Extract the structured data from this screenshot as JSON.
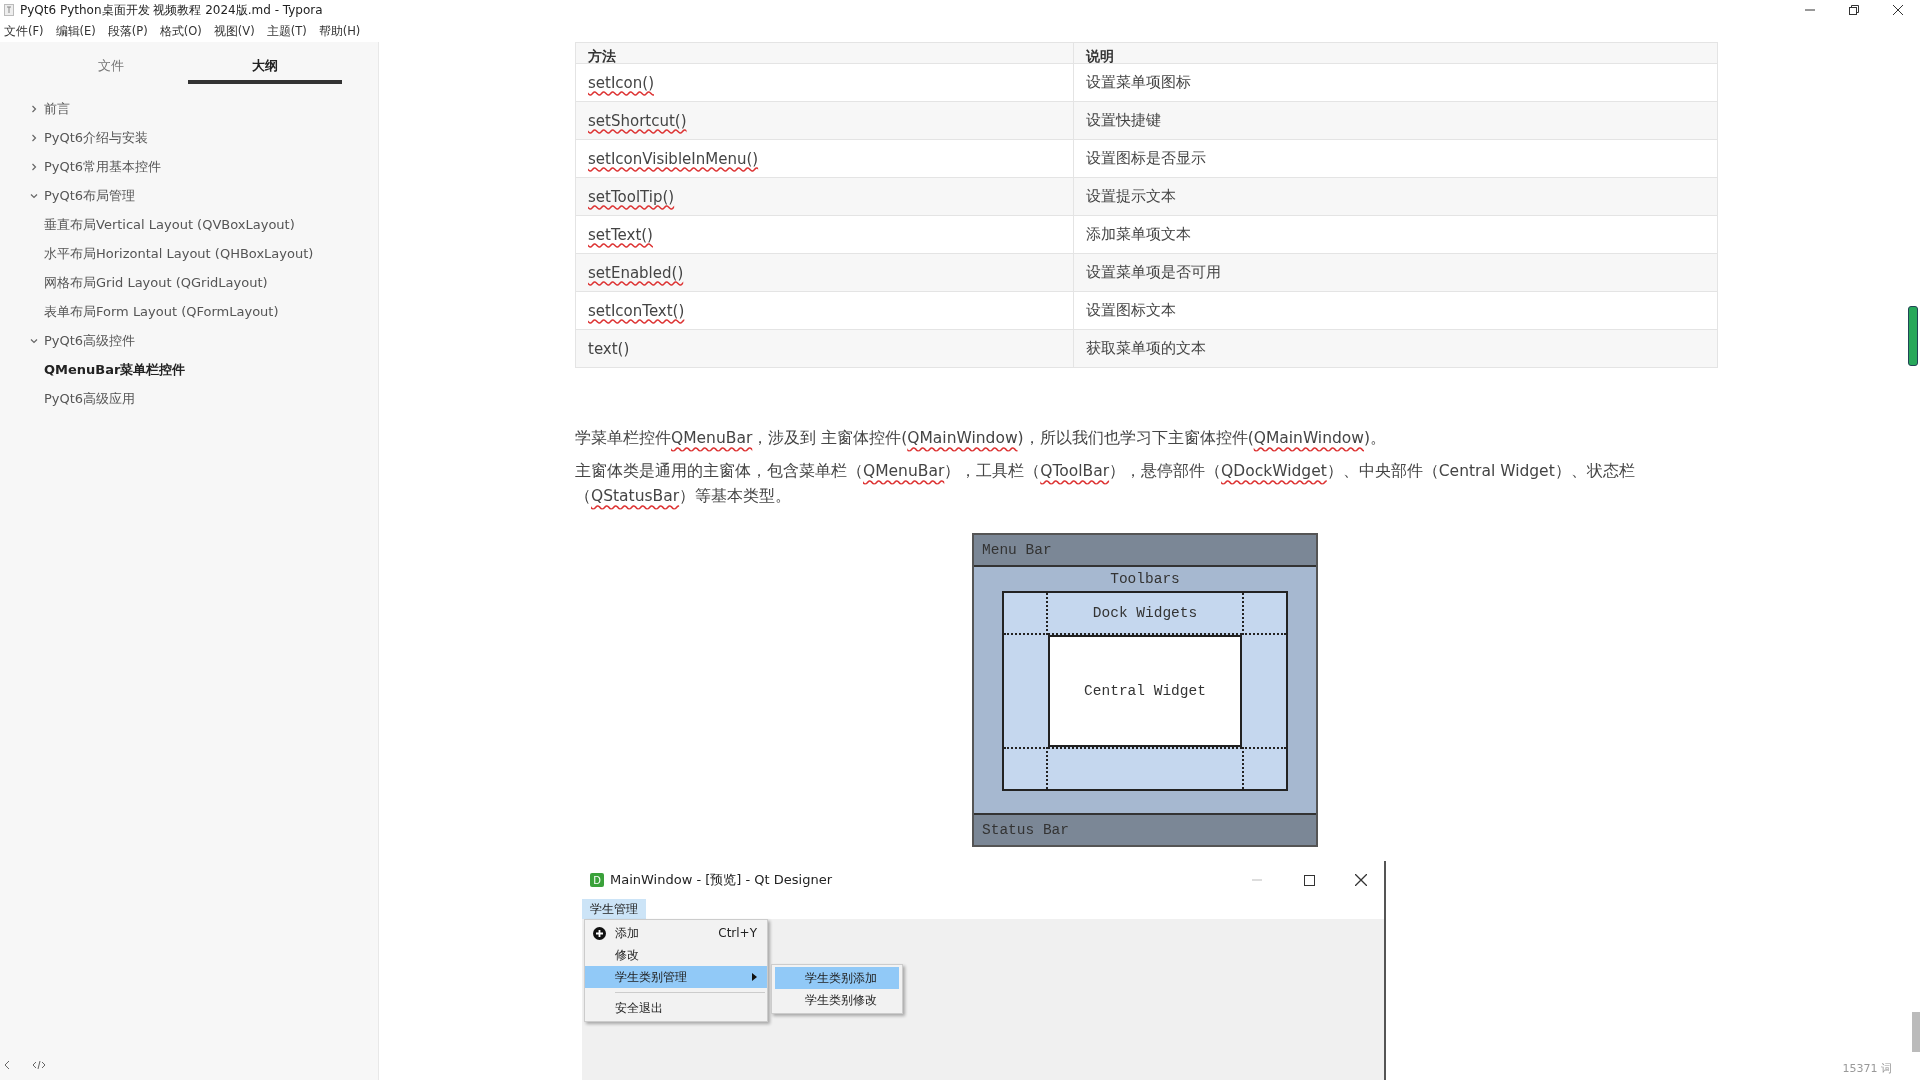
{
  "window": {
    "title": "PyQt6 Python桌面开发 视频教程 2024版.md - Typora"
  },
  "menu": [
    {
      "label": "文件(F)"
    },
    {
      "label": "编辑(E)"
    },
    {
      "label": "段落(P)"
    },
    {
      "label": "格式(O)"
    },
    {
      "label": "视图(V)"
    },
    {
      "label": "主题(T)"
    },
    {
      "label": "帮助(H)"
    }
  ],
  "sidebar": {
    "tabs": [
      {
        "label": "文件",
        "selected": false
      },
      {
        "label": "大纲",
        "selected": true
      }
    ],
    "items": [
      {
        "label": "前言",
        "expanded": false
      },
      {
        "label": "PyQt6介绍与安装",
        "expanded": false
      },
      {
        "label": "PyQt6常用基本控件",
        "expanded": false
      },
      {
        "label": "PyQt6布局管理",
        "expanded": true,
        "children": [
          {
            "label": "垂直布局Vertical Layout (QVBoxLayout)",
            "current": false
          },
          {
            "label": "水平布局Horizontal Layout (QHBoxLayout)",
            "current": false
          },
          {
            "label": "网格布局Grid Layout (QGridLayout)",
            "current": false
          },
          {
            "label": "表单布局Form Layout (QFormLayout)",
            "current": false
          }
        ]
      },
      {
        "label": "PyQt6高级控件",
        "expanded": true,
        "children": [
          {
            "label": "QMenuBar菜单栏控件",
            "current": true
          }
        ]
      },
      {
        "label": "PyQt6高级应用"
      }
    ]
  },
  "table": {
    "columns": [
      "方法",
      "说明"
    ],
    "rows": [
      {
        "method": "setIcon()",
        "misspelled": true,
        "description": "设置菜单项图标"
      },
      {
        "method": "setShortcut()",
        "misspelled": true,
        "description": "设置快捷键"
      },
      {
        "method": "setIconVisibleInMenu()",
        "misspelled": true,
        "description": "设置图标是否显示"
      },
      {
        "method": "setToolTip()",
        "misspelled": true,
        "description": "设置提示文本"
      },
      {
        "method": "setText()",
        "misspelled": true,
        "description": "添加菜单项文本"
      },
      {
        "method": "setEnabled()",
        "misspelled": true,
        "description": "设置菜单项是否可用"
      },
      {
        "method": "setIconText()",
        "misspelled": true,
        "description": "设置图标文本"
      },
      {
        "method": "text()",
        "misspelled": false,
        "description": "获取菜单项的文本"
      }
    ]
  },
  "paragraphs": [
    [
      {
        "text": "学菜单栏控件",
        "misspelled": false
      },
      {
        "text": "QMenuBar",
        "misspelled": true
      },
      {
        "text": "，涉及到 主窗体控件(",
        "misspelled": false
      },
      {
        "text": "QMainWindow",
        "misspelled": true
      },
      {
        "text": ")，所以我们也学习下主窗体控件(",
        "misspelled": false
      },
      {
        "text": "QMainWindow",
        "misspelled": true
      },
      {
        "text": ")。",
        "misspelled": false
      }
    ],
    [
      {
        "text": "主窗体类是通用的主窗体，包含菜单栏（",
        "misspelled": false
      },
      {
        "text": "QMenuBar",
        "misspelled": true
      },
      {
        "text": "），工具栏（",
        "misspelled": false
      },
      {
        "text": "QToolBar",
        "misspelled": true
      },
      {
        "text": "），悬停部件（",
        "misspelled": false
      },
      {
        "text": "QDockWidget",
        "misspelled": true
      },
      {
        "text": "）、中央部件（Central Widget）、状态栏（",
        "misspelled": false
      },
      {
        "text": "QStatusBar",
        "misspelled": true
      },
      {
        "text": "）等基本类型。",
        "misspelled": false
      }
    ]
  ],
  "diagram": {
    "menu_bar": "Menu Bar",
    "toolbars": "Toolbars",
    "dock_widgets": "Dock Widgets",
    "central_widget": "Central Widget",
    "status_bar": "Status Bar"
  },
  "qt_window": {
    "icon_letter": "D",
    "title": "MainWindow - [预览] - Qt Designer",
    "menubar": [
      {
        "label": "学生管理",
        "selected": true
      }
    ],
    "menu": [
      {
        "kind": "item",
        "label": "添加",
        "shortcut": "Ctrl+Y",
        "icon": true,
        "submenu": false,
        "selected": false
      },
      {
        "kind": "item",
        "label": "修改",
        "icon": false,
        "submenu": false,
        "selected": false
      },
      {
        "kind": "item",
        "label": "学生类别管理",
        "icon": false,
        "submenu": true,
        "selected": true
      },
      {
        "kind": "separator"
      },
      {
        "kind": "item",
        "label": "安全退出",
        "icon": false,
        "submenu": false,
        "selected": false
      }
    ],
    "submenu": [
      {
        "label": "学生类别添加",
        "selected": true
      },
      {
        "label": "学生类别修改",
        "selected": false
      }
    ]
  },
  "status_bar": {
    "word_count": "15371 词"
  }
}
